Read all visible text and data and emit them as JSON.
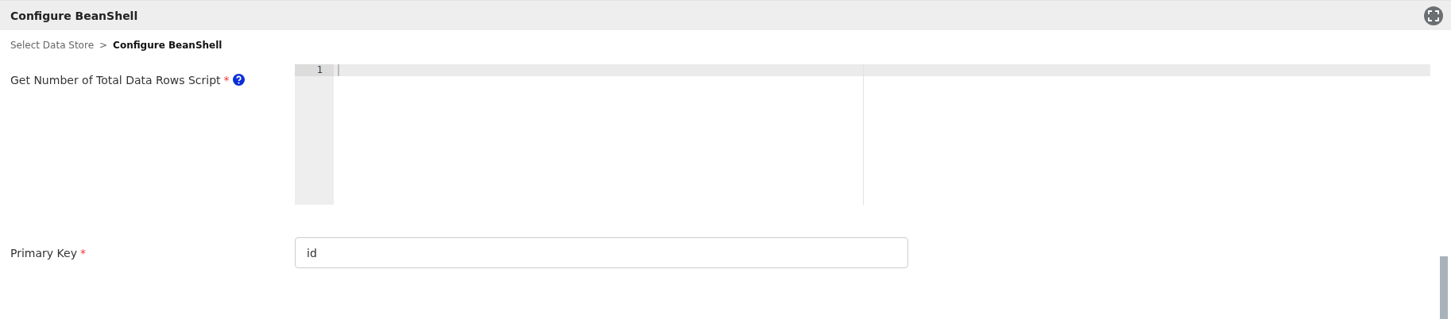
{
  "header": {
    "title": "Configure BeanShell"
  },
  "breadcrumb": [
    {
      "label": "Select Data Store",
      "selected": false
    },
    {
      "label": "Configure BeanShell",
      "selected": true
    }
  ],
  "breadcrumb_separator": ">",
  "fields": [
    {
      "kind": "code",
      "label": "Get Number of Total Data Rows Script",
      "required": true,
      "help": true,
      "line_numbers": [
        "1"
      ]
    },
    {
      "kind": "text",
      "label": "Primary Key",
      "required": true,
      "help": false,
      "value": "id"
    }
  ],
  "required_mark": "*"
}
